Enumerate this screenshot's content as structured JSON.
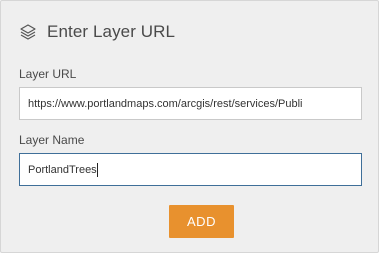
{
  "header": {
    "title": "Enter Layer URL",
    "icon": "layers-icon"
  },
  "layer_url": {
    "label": "Layer URL",
    "value": "https://www.portlandmaps.com/arcgis/rest/services/Publi"
  },
  "layer_name": {
    "label": "Layer Name",
    "value": "PortlandTrees"
  },
  "add_button": {
    "label": "ADD"
  },
  "colors": {
    "accent": "#e8912e",
    "focus_border": "#3f6f99",
    "panel_bg": "#efefef"
  }
}
